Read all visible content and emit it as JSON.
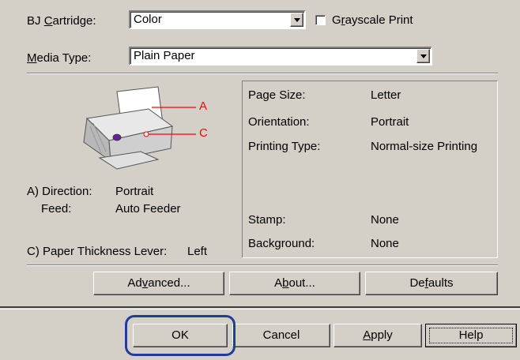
{
  "cartridge": {
    "label_pre": "BJ ",
    "label_u": "C",
    "label_post": "artridge:",
    "value": "Color"
  },
  "grayscale": {
    "label_pre": "G",
    "label_u": "r",
    "label_post": "ayscale Print",
    "checked": false
  },
  "media": {
    "label_u": "M",
    "label_post": "edia Type:",
    "value": "Plain Paper"
  },
  "printer_callouts": {
    "a": "A",
    "c": "C"
  },
  "direction": {
    "label": "A) Direction:",
    "value": "Portrait"
  },
  "feed": {
    "label": "Feed:",
    "value": "Auto Feeder"
  },
  "thickness": {
    "label": "C) Paper Thickness Lever:",
    "value": "Left"
  },
  "info": {
    "page_size": {
      "label": "Page Size:",
      "value": "Letter"
    },
    "orientation": {
      "label": "Orientation:",
      "value": "Portrait"
    },
    "printing_type": {
      "label": "Printing Type:",
      "value": "Normal-size Printing"
    },
    "stamp": {
      "label": "Stamp:",
      "value": "None"
    },
    "background": {
      "label": "Background:",
      "value": "None"
    }
  },
  "buttons": {
    "advanced": {
      "pre": "Ad",
      "u": "v",
      "post": "anced..."
    },
    "about": {
      "pre": "A",
      "u": "b",
      "post": "out..."
    },
    "defaults": {
      "pre": "De",
      "u": "f",
      "post": "aults"
    },
    "ok": "OK",
    "cancel": "Cancel",
    "apply": {
      "pre": "",
      "u": "A",
      "post": "pply"
    },
    "help": "Help"
  },
  "colors": {
    "face": "#d4d0c8",
    "callout_red": "#ff0000",
    "highlight_ring": "#1f3d99"
  },
  "icons": [
    "dropdown-arrow-icon",
    "printer-illustration",
    "checkbox-icon"
  ]
}
